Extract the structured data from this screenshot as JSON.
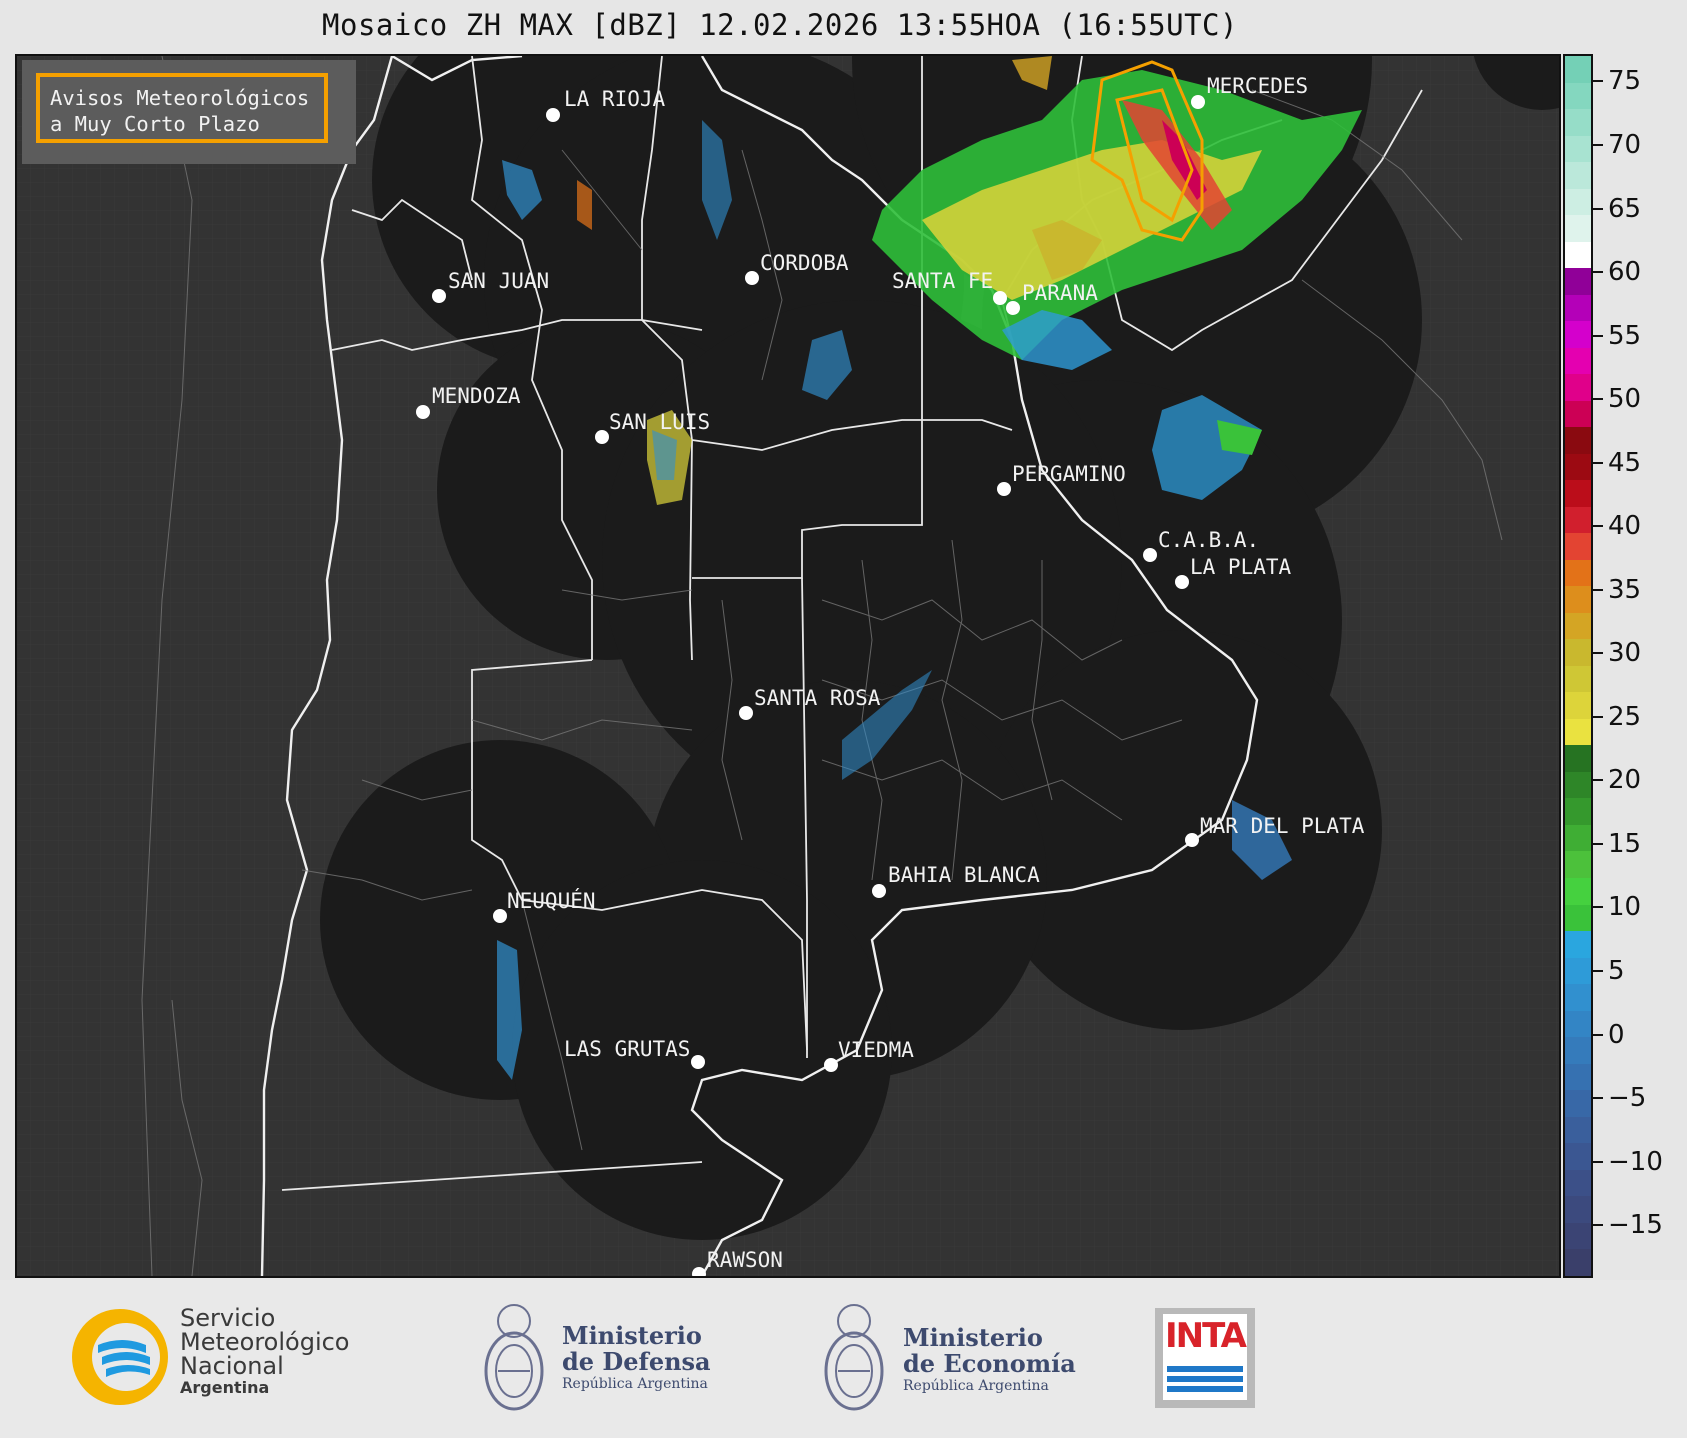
{
  "title": "Mosaico ZH MAX [dBZ] 12.02.2026 13:55HOA (16:55UTC)",
  "alert_box": {
    "line1": "Avisos Meteorológicos",
    "line2": "a Muy Corto Plazo",
    "border_color": "#f5a000"
  },
  "cities": [
    {
      "name": "LA RIOJA"
    },
    {
      "name": "CORDOBA"
    },
    {
      "name": "SAN JUAN"
    },
    {
      "name": "SANTA FE"
    },
    {
      "name": "PARANA"
    },
    {
      "name": "MERCEDES"
    },
    {
      "name": "MENDOZA"
    },
    {
      "name": "SAN LUIS"
    },
    {
      "name": "PERGAMINO"
    },
    {
      "name": "C.A.B.A."
    },
    {
      "name": "LA PLATA"
    },
    {
      "name": "SANTA ROSA"
    },
    {
      "name": "MAR DEL PLATA"
    },
    {
      "name": "BAHIA BLANCA"
    },
    {
      "name": "NEUQUÉN"
    },
    {
      "name": "LAS GRUTAS"
    },
    {
      "name": "VIEDMA"
    },
    {
      "name": "RAWSON"
    }
  ],
  "colorbar": {
    "ticks": [
      "75",
      "70",
      "65",
      "60",
      "55",
      "50",
      "45",
      "40",
      "35",
      "30",
      "25",
      "20",
      "15",
      "10",
      "5",
      "0",
      "−5",
      "−10",
      "−15"
    ],
    "range": [
      -19,
      77
    ],
    "colors": [
      "#3a3f6a",
      "#3b4474",
      "#3c4a7e",
      "#3c5088",
      "#3b5792",
      "#3a5f9c",
      "#3868a7",
      "#3671b1",
      "#357bbb",
      "#3385c5",
      "#3190cf",
      "#2e9bd8",
      "#2aa6df",
      "#3ac23a",
      "#45d13f",
      "#4cc13b",
      "#3fae34",
      "#35992d",
      "#2e8628",
      "#267322",
      "#eae240",
      "#ddd43a",
      "#cfc735",
      "#c9b82e",
      "#d4a524",
      "#dd8e1c",
      "#e37218",
      "#e34432",
      "#d11f2d",
      "#bb0d1a",
      "#9c0a12",
      "#8a0a10",
      "#cc0055",
      "#e0008a",
      "#e400b0",
      "#d400cc",
      "#b400b8",
      "#900098",
      "#ffffff",
      "#dff3ec",
      "#cdeee3",
      "#bbe8da",
      "#a8e3d1",
      "#96ddc8",
      "#84d7bf",
      "#74d0b6"
    ]
  },
  "footer": {
    "smn_line1": "Servicio",
    "smn_line2": "Meteorológico",
    "smn_line3": "Nacional",
    "smn_line4": "Argentina",
    "def_line1": "Ministerio",
    "def_line2": "de Defensa",
    "def_line3": "República Argentina",
    "eco_line1": "Ministerio",
    "eco_line2": "de Economía",
    "eco_line3": "República Argentina",
    "inta": "INTA"
  }
}
